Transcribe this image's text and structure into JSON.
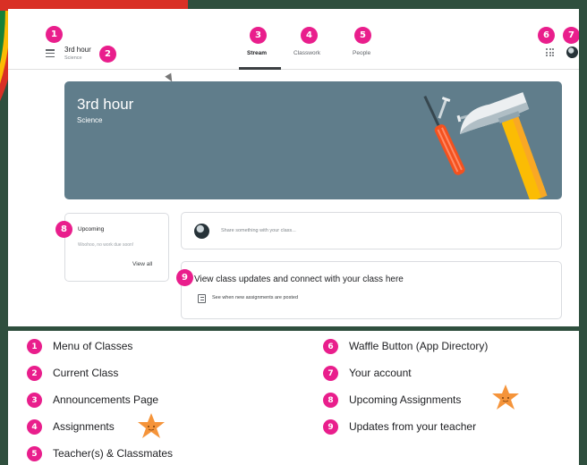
{
  "header": {
    "class_name": "3rd hour",
    "class_subject": "Science",
    "tabs": [
      {
        "label": "Stream"
      },
      {
        "label": "Classwork"
      },
      {
        "label": "People"
      }
    ]
  },
  "banner": {
    "title": "3rd hour",
    "subtitle": "Science"
  },
  "upcoming": {
    "title": "Upcoming",
    "note": "Woohoo, no work due soon!",
    "link": "View all"
  },
  "share": {
    "placeholder": "Share something with your class..."
  },
  "updates": {
    "title": "View class updates and connect with your class here",
    "subtitle": "See when new assignments are posted"
  },
  "badges": [
    "1",
    "2",
    "3",
    "4",
    "5",
    "6",
    "7",
    "8",
    "9"
  ],
  "legend": [
    {
      "num": "1",
      "text": "Menu of Classes"
    },
    {
      "num": "2",
      "text": "Current Class"
    },
    {
      "num": "3",
      "text": "Announcements Page"
    },
    {
      "num": "4",
      "text": "Assignments"
    },
    {
      "num": "5",
      "text": "Teacher(s) & Classmates"
    },
    {
      "num": "6",
      "text": "Waffle Button (App Directory)"
    },
    {
      "num": "7",
      "text": "Your account"
    },
    {
      "num": "8",
      "text": "Upcoming Assignments"
    },
    {
      "num": "9",
      "text": "Updates from your teacher"
    }
  ],
  "colors": {
    "badge": "#e91e8c",
    "banner": "#607d8b",
    "frame": "#2f4f3e",
    "star": "#f5943a"
  }
}
